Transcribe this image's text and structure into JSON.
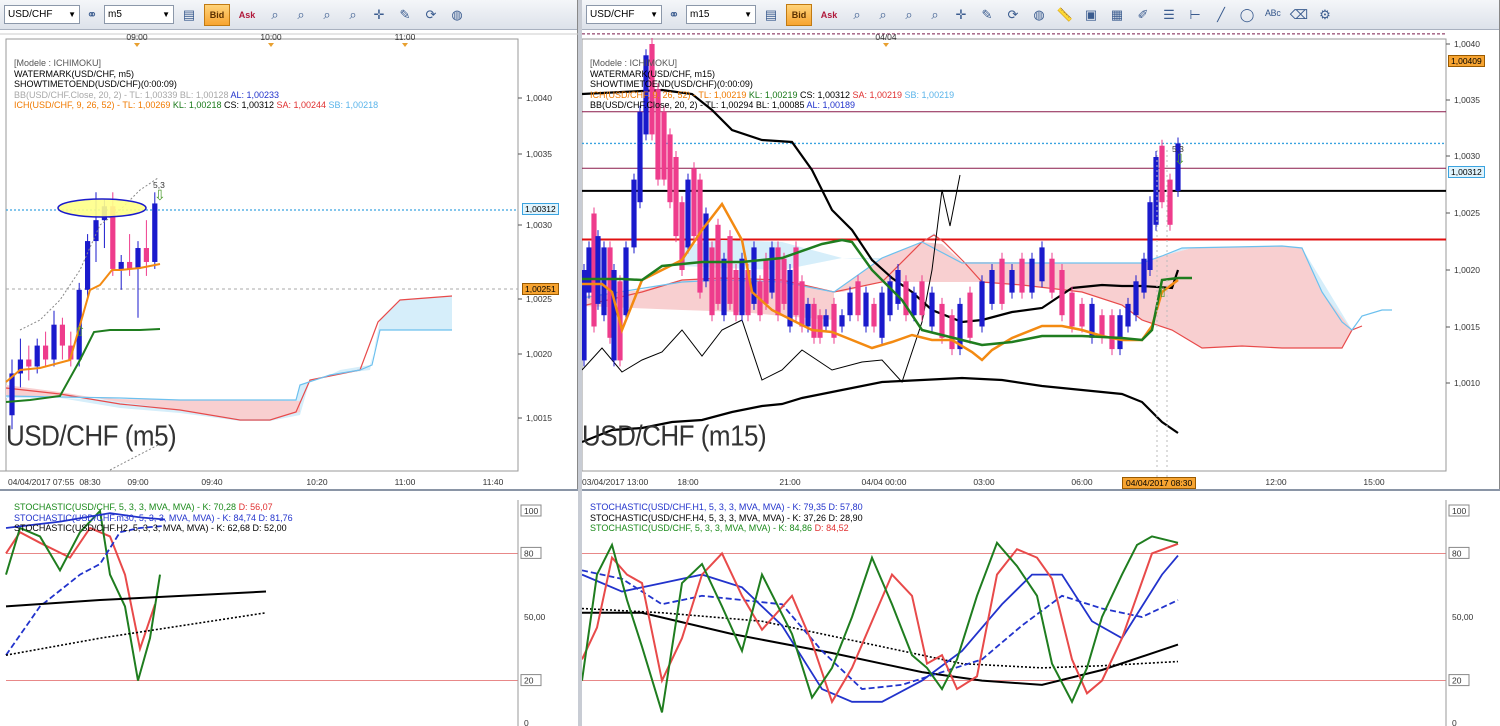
{
  "left": {
    "symbol": "USD/CHF",
    "timeframe": "m5",
    "bid_label": "Bid",
    "ask_label": "Ask",
    "top_time_labels": [
      "09:00",
      "10:00",
      "11:00"
    ],
    "legend": [
      {
        "text": "[Modele : ICHIMOKU]",
        "color": "#555555"
      },
      {
        "text": "WATERMARK(USD/CHF, m5)",
        "color": "#000000"
      },
      {
        "text": "SHOWTIMETOEND(USD/CHF)(0:00:09)",
        "color": "#000000"
      },
      {
        "parts": [
          {
            "t": "BB(USD/CHF.Close, 20, 2) -  TL: 1,00339  BL: 1,00128  ",
            "c": "#a8a8a8"
          },
          {
            "t": "AL: 1,00233",
            "c": "#2233cc"
          }
        ]
      },
      {
        "parts": [
          {
            "t": "ICH(USD/CHF, 9, 26, 52) -  TL: 1,00269  ",
            "c": "#f07a00"
          },
          {
            "t": "KL: 1,00218  ",
            "c": "#1b7a1b"
          },
          {
            "t": "CS: 1,00312  ",
            "c": "#000000"
          },
          {
            "t": "SA: 1,00244  ",
            "c": "#e03030"
          },
          {
            "t": "SB: 1,00218",
            "c": "#5ab4ea"
          }
        ]
      }
    ],
    "price_labels": [
      "1,0040",
      "1,0035",
      "1,0030",
      "1,0025",
      "1,0020",
      "1,0015"
    ],
    "current_price": "1,00312",
    "other_price": "1,00251",
    "watermark": "USD/CHF (m5)",
    "bottom_time_labels": [
      "04/04/2017 07:55",
      "08:30",
      "09:00",
      "09:40",
      "10:20",
      "11:00",
      "11:40"
    ],
    "signal_label": "5,3",
    "stoch_legend": [
      {
        "parts": [
          {
            "t": "STOCHASTIC(USD/CHF, 5, 3, 3, MVA, MVA) -  K: 70,28  ",
            "c": "#1b8a1b"
          },
          {
            "t": "D: 56,07",
            "c": "#e03030"
          }
        ]
      },
      {
        "parts": [
          {
            "t": "STOCHASTIC(USD/CHF.m30, 5, 3, 3, MVA, MVA) -  K: 84,74  D: 81,76",
            "c": "#2233cc"
          }
        ]
      },
      {
        "parts": [
          {
            "t": "STOCHASTIC(USD/CHF.H2, 5, 3, 3, MVA, MVA) -  K: 62,68  D: 52,00",
            "c": "#000000"
          }
        ]
      }
    ],
    "stoch_labels": [
      "100",
      "80",
      "50,00",
      "20",
      "0"
    ]
  },
  "right": {
    "symbol": "USD/CHF",
    "timeframe": "m15",
    "bid_label": "Bid",
    "ask_label": "Ask",
    "top_time_labels": [
      "04/04"
    ],
    "legend": [
      {
        "text": "[Modele : ICHIMOKU]",
        "color": "#555555"
      },
      {
        "text": "WATERMARK(USD/CHF, m15)",
        "color": "#000000"
      },
      {
        "text": "SHOWTIMETOEND(USD/CHF)(0:00:09)",
        "color": "#000000"
      },
      {
        "parts": [
          {
            "t": "ICH(USD/CHF, 9, 26, 52) -  TL: 1,00219  ",
            "c": "#f07a00"
          },
          {
            "t": "KL: 1,00219  ",
            "c": "#1b7a1b"
          },
          {
            "t": "CS: 1,00312  ",
            "c": "#000000"
          },
          {
            "t": "SA: 1,00219  ",
            "c": "#e03030"
          },
          {
            "t": "SB: 1,00219",
            "c": "#5ab4ea"
          }
        ]
      },
      {
        "parts": [
          {
            "t": "BB(USD/CHF.Close, 20, 2) -  TL: 1,00294  BL: 1,00085  ",
            "c": "#000000"
          },
          {
            "t": "AL: 1,00189",
            "c": "#2233cc"
          }
        ]
      }
    ],
    "price_labels": [
      "1,0040",
      "1,0035",
      "1,0030",
      "1,0025",
      "1,0020",
      "1,0015",
      "1,0010"
    ],
    "current_price": "1,00312",
    "top_price": "1,00409",
    "watermark": "USD/CHF (m15)",
    "bottom_time_labels": [
      "03/04/2017 13:00",
      "18:00",
      "21:00",
      "04/04 00:00",
      "03:00",
      "06:00",
      "12:00",
      "15:00"
    ],
    "current_time_label": "04/04/2017 08:30",
    "signal_label": "5,3",
    "stoch_legend": [
      {
        "parts": [
          {
            "t": "STOCHASTIC(USD/CHF.H1, 5, 3, 3, MVA, MVA) -  K: 79,35  D: 57,80",
            "c": "#2233cc"
          }
        ]
      },
      {
        "parts": [
          {
            "t": "STOCHASTIC(USD/CHF.H4, 5, 3, 3, MVA, MVA) -  K: 37,26  D: 28,90",
            "c": "#000000"
          }
        ]
      },
      {
        "parts": [
          {
            "t": "STOCHASTIC(USD/CHF, 5, 3, 3, MVA, MVA) -  K: 84,86  ",
            "c": "#1b8a1b"
          },
          {
            "t": "D: 84,52",
            "c": "#e03030"
          }
        ]
      }
    ],
    "stoch_labels": [
      "100",
      "80",
      "50,00",
      "20",
      "0"
    ]
  },
  "chart_data": [
    {
      "type": "line",
      "title": "USD/CHF (m5)",
      "ylim": [
        1.0012,
        1.0043
      ],
      "current_price": 1.00312,
      "series": [
        {
          "name": "ICH TL",
          "values": [
            1.00269
          ]
        },
        {
          "name": "ICH KL",
          "values": [
            1.00218
          ]
        },
        {
          "name": "ICH SA",
          "values": [
            1.00244
          ]
        },
        {
          "name": "ICH SB",
          "values": [
            1.00218
          ]
        }
      ],
      "candles": [
        [
          1.0016,
          1.002,
          1.0015,
          1.0019,
          "up"
        ],
        [
          1.0019,
          1.00215,
          1.0018,
          1.002,
          "up"
        ],
        [
          1.002,
          1.0021,
          1.00185,
          1.00195,
          "down"
        ],
        [
          1.00195,
          1.00215,
          1.0019,
          1.0021,
          "up"
        ],
        [
          1.0021,
          1.0022,
          1.00195,
          1.002,
          "down"
        ],
        [
          1.002,
          1.00235,
          1.00195,
          1.00225,
          "up"
        ],
        [
          1.00225,
          1.0023,
          1.002,
          1.0021,
          "down"
        ],
        [
          1.0021,
          1.0022,
          1.00195,
          1.002,
          "down"
        ],
        [
          1.002,
          1.00255,
          1.00195,
          1.0025,
          "up"
        ],
        [
          1.0025,
          1.0029,
          1.00245,
          1.00285,
          "up"
        ],
        [
          1.00285,
          1.0032,
          1.0027,
          1.003,
          "up"
        ],
        [
          1.003,
          1.00315,
          1.0028,
          1.0031,
          "up"
        ],
        [
          1.0031,
          1.0032,
          1.0026,
          1.00265,
          "down"
        ],
        [
          1.00265,
          1.00275,
          1.0025,
          1.0027,
          "up"
        ],
        [
          1.0027,
          1.0029,
          1.0026,
          1.00265,
          "down"
        ],
        [
          1.00265,
          1.00285,
          1.0023,
          1.0028,
          "up"
        ],
        [
          1.0028,
          1.003,
          1.0026,
          1.0027,
          "down"
        ],
        [
          1.0027,
          1.0032,
          1.00265,
          1.00312,
          "up"
        ]
      ]
    },
    {
      "type": "line",
      "title": "USD/CHF (m15)",
      "ylim": [
        1.0005,
        1.0042
      ],
      "current_price": 1.00312,
      "series": [
        {
          "name": "ICH TL",
          "values": [
            1.00219
          ]
        },
        {
          "name": "ICH KL",
          "values": [
            1.00219
          ]
        },
        {
          "name": "ICH SA",
          "values": [
            1.00219
          ]
        },
        {
          "name": "ICH SB",
          "values": [
            1.00219
          ]
        },
        {
          "name": "BB TL",
          "values": [
            1.00294
          ]
        },
        {
          "name": "BB BL",
          "values": [
            1.00085
          ]
        },
        {
          "name": "BB AL",
          "values": [
            1.00189
          ]
        }
      ],
      "levels": [
        1.00409,
        1.0034,
        1.0029,
        1.0027,
        1.00227
      ]
    },
    {
      "type": "line",
      "title": "STOCHASTIC",
      "ylim": [
        0,
        100
      ],
      "series": [
        {
          "name": "STOCHASTIC(USD/CHF, 5, 3, 3, MVA, MVA) K",
          "values": [
            70.28
          ]
        },
        {
          "name": "STOCHASTIC(USD/CHF, 5, 3, 3, MVA, MVA) D",
          "values": [
            56.07
          ]
        },
        {
          "name": "STOCHASTIC(USD/CHF.m30) K",
          "values": [
            84.74
          ]
        },
        {
          "name": "STOCHASTIC(USD/CHF.m30) D",
          "values": [
            81.76
          ]
        },
        {
          "name": "STOCHASTIC(USD/CHF.H2) K",
          "values": [
            62.68
          ]
        },
        {
          "name": "STOCHASTIC(USD/CHF.H2) D",
          "values": [
            52.0
          ]
        },
        {
          "name": "STOCHASTIC(USD/CHF.H1) K",
          "values": [
            79.35
          ]
        },
        {
          "name": "STOCHASTIC(USD/CHF.H1) D",
          "values": [
            57.8
          ]
        },
        {
          "name": "STOCHASTIC(USD/CHF.H4) K",
          "values": [
            37.26
          ]
        },
        {
          "name": "STOCHASTIC(USD/CHF.H4) D",
          "values": [
            28.9
          ]
        },
        {
          "name": "STOCHASTIC(USD/CHF m15) K",
          "values": [
            84.86
          ]
        },
        {
          "name": "STOCHASTIC(USD/CHF m15) D",
          "values": [
            84.52
          ]
        }
      ]
    }
  ],
  "colors": {
    "up_candle": "#1a1acc",
    "down_candle": "#ee3c8c",
    "tenkan": "#f38a12",
    "kijun": "#1f7d1f",
    "senkou_a": "#e84a4a",
    "senkou_b": "#6cc0ee",
    "cloud_bull": "#d6eefa",
    "cloud_bear": "#f8cfd0",
    "current_line": "#3aa3e0"
  },
  "icons": [
    "currency-pair-select",
    "chain-link-icon",
    "timeframe-select",
    "chart-type-icon",
    "bid-button",
    "ask-button",
    "indicator-icons",
    "line-style-icon",
    "template-icon",
    "refresh-icon",
    "globe-icon"
  ]
}
